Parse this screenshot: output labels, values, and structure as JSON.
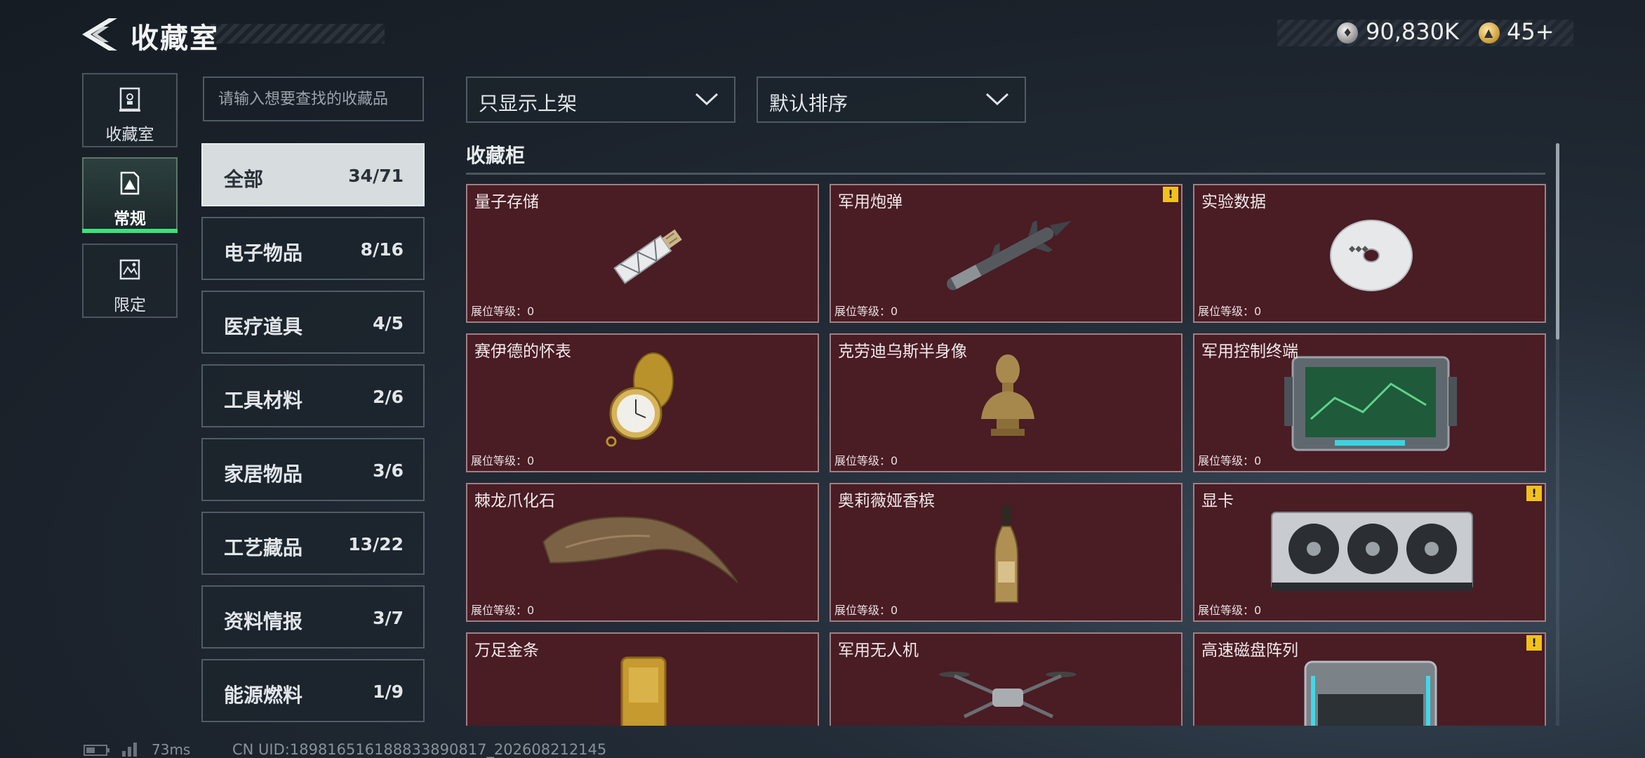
{
  "header": {
    "title": "收藏室",
    "currency": {
      "money": "90,830K",
      "gems": "45+"
    }
  },
  "side_tabs": [
    {
      "label": "收藏室",
      "icon": "cabinet-icon"
    },
    {
      "label": "常规",
      "icon": "regular-collection-icon",
      "selected": true
    },
    {
      "label": "限定",
      "icon": "limited-collection-icon"
    }
  ],
  "search": {
    "placeholder": "请输入想要查找的收藏品"
  },
  "categories": [
    {
      "name": "全部",
      "count": "34/71",
      "selected": true
    },
    {
      "name": "电子物品",
      "count": "8/16"
    },
    {
      "name": "医疗道具",
      "count": "4/5"
    },
    {
      "name": "工具材料",
      "count": "2/6"
    },
    {
      "name": "家居物品",
      "count": "3/6"
    },
    {
      "name": "工艺藏品",
      "count": "13/22"
    },
    {
      "name": "资料情报",
      "count": "3/7"
    },
    {
      "name": "能源燃料",
      "count": "1/9"
    }
  ],
  "filters": {
    "display": "只显示上架",
    "sort": "默认排序"
  },
  "section": {
    "title": "收藏柜"
  },
  "items": [
    {
      "name": "量子存储",
      "level": "展位等级：0",
      "icon": "usb-drive-icon",
      "warning": false
    },
    {
      "name": "军用炮弹",
      "level": "展位等级：0",
      "icon": "missile-icon",
      "warning": true
    },
    {
      "name": "实验数据",
      "level": "展位等级：0",
      "icon": "disc-icon",
      "warning": false
    },
    {
      "name": "赛伊德的怀表",
      "level": "展位等级：0",
      "icon": "pocket-watch-icon",
      "warning": false
    },
    {
      "name": "克劳迪乌斯半身像",
      "level": "展位等级：0",
      "icon": "bust-icon",
      "warning": false
    },
    {
      "name": "军用控制终端",
      "level": "展位等级：0",
      "icon": "control-terminal-icon",
      "warning": false
    },
    {
      "name": "棘龙爪化石",
      "level": "展位等级：0",
      "icon": "claw-fossil-icon",
      "warning": false
    },
    {
      "name": "奥莉薇娅香槟",
      "level": "展位等级：0",
      "icon": "champagne-icon",
      "warning": false
    },
    {
      "name": "显卡",
      "level": "展位等级：0",
      "icon": "graphics-card-icon",
      "warning": true
    },
    {
      "name": "万足金条",
      "level": "",
      "icon": "gold-bar-icon",
      "warning": false
    },
    {
      "name": "军用无人机",
      "level": "",
      "icon": "drone-icon",
      "warning": false
    },
    {
      "name": "高速磁盘阵列",
      "level": "",
      "icon": "disk-array-icon",
      "warning": true
    }
  ],
  "warning_symbol": "!",
  "footer": {
    "ping": "73ms",
    "uid": "CN UID:18981651618883389081​7_202608212145"
  }
}
